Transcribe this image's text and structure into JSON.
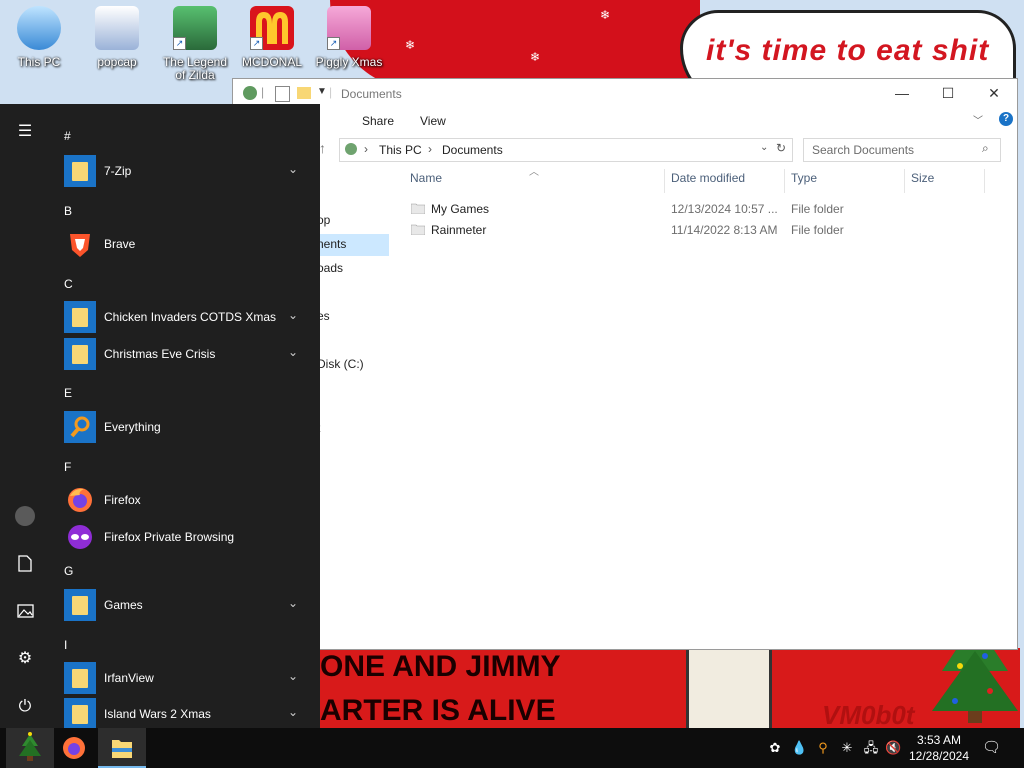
{
  "wallpaper": {
    "bubble_text": "it's time to eat shit",
    "banner_line1": "ONE AND JIMMY",
    "banner_line2": "ARTER IS ALIVE",
    "signature": "VM0b0t"
  },
  "desktop_icons": [
    {
      "label": "This PC"
    },
    {
      "label": "popcap"
    },
    {
      "label": "The Legend of Zilda"
    },
    {
      "label": "MCDONAL"
    },
    {
      "label": "Piggly Xmas"
    }
  ],
  "explorer": {
    "title": "Documents",
    "ribbon_tabs": [
      "Share",
      "View"
    ],
    "breadcrumb": [
      "This PC",
      "Documents"
    ],
    "search_placeholder": "Search Documents",
    "columns": {
      "name": "Name",
      "date": "Date modified",
      "type": "Type",
      "size": "Size"
    },
    "files": [
      {
        "name": "My Games",
        "date": "12/13/2024 10:57 ...",
        "type": "File folder"
      },
      {
        "name": "Rainmeter",
        "date": "11/14/2022 8:13 AM",
        "type": "File folder"
      }
    ],
    "nav_partial": [
      "op",
      "nents",
      "oads",
      "es",
      "Disk (C:)",
      "t"
    ]
  },
  "start_menu": {
    "groups": [
      {
        "letter": "#",
        "apps": [
          {
            "label": "7-Zip",
            "icon": "folder",
            "expandable": true
          }
        ]
      },
      {
        "letter": "B",
        "apps": [
          {
            "label": "Brave",
            "icon": "brave",
            "expandable": false
          }
        ]
      },
      {
        "letter": "C",
        "apps": [
          {
            "label": "Chicken Invaders COTDS Xmas",
            "icon": "folder",
            "expandable": true
          },
          {
            "label": "Christmas Eve Crisis",
            "icon": "folder",
            "expandable": true
          }
        ]
      },
      {
        "letter": "E",
        "apps": [
          {
            "label": "Everything",
            "icon": "search",
            "expandable": false
          }
        ]
      },
      {
        "letter": "F",
        "apps": [
          {
            "label": "Firefox",
            "icon": "firefox",
            "expandable": false
          },
          {
            "label": "Firefox Private Browsing",
            "icon": "firefox-private",
            "expandable": false
          }
        ]
      },
      {
        "letter": "G",
        "apps": [
          {
            "label": "Games",
            "icon": "folder",
            "expandable": true
          }
        ]
      },
      {
        "letter": "I",
        "apps": [
          {
            "label": "IrfanView",
            "icon": "folder",
            "expandable": true
          },
          {
            "label": "Island Wars 2 Xmas",
            "icon": "folder",
            "expandable": true
          }
        ]
      }
    ],
    "rail": [
      "hamburger-icon",
      "user-icon",
      "documents-icon",
      "pictures-icon",
      "settings-icon",
      "power-icon"
    ]
  },
  "taskbar": {
    "time": "3:53 AM",
    "date": "12/28/2024"
  },
  "colors": {
    "accent": "#1a73c7",
    "start_bg": "#1f1f1f",
    "taskbar_bg": "#0d0d0d",
    "banner_red": "#d81a1a"
  }
}
